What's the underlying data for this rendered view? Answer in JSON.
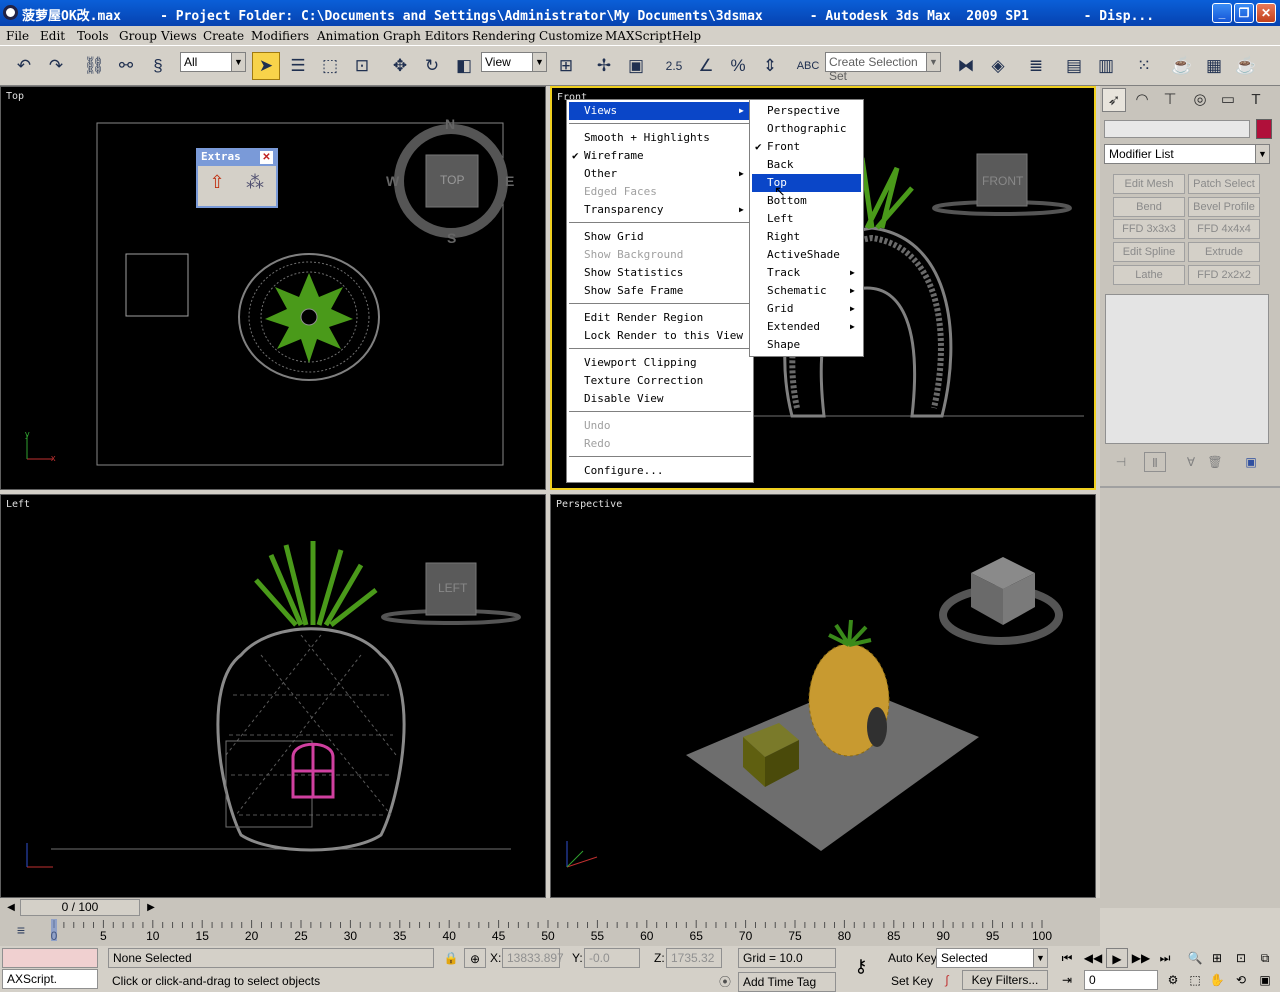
{
  "window": {
    "title": "菠萝屋OK改.max     - Project Folder: C:\\Documents and Settings\\Administrator\\My Documents\\3dsmax      - Autodesk 3ds Max  2009 SP1       - Disp..."
  },
  "menu": [
    "File",
    "Edit",
    "Tools",
    "Group",
    "Views",
    "Create",
    "Modifiers",
    "Animation",
    "Graph Editors",
    "Rendering",
    "Customize",
    "MAXScript",
    "Help"
  ],
  "toolbar": {
    "filter": "All",
    "refcoord": "View",
    "selection_set": "Create Selection Set",
    "snap_value": "2.5"
  },
  "viewports": {
    "top": "Top",
    "front": "Front",
    "left": "Left",
    "persp": "Perspective"
  },
  "viewcube": {
    "top": "TOP",
    "front": "FRONT",
    "left": "LEFT",
    "n": "N",
    "s": "S",
    "e": "E",
    "w": "W"
  },
  "extras": {
    "title": "Extras"
  },
  "context_menu": [
    {
      "label": "Views",
      "sub": true,
      "hl": true
    },
    {
      "label": "Smooth + Highlights"
    },
    {
      "label": "Wireframe",
      "check": true
    },
    {
      "label": "Other",
      "sub": true
    },
    {
      "label": "Edged Faces",
      "dis": true
    },
    {
      "label": "Transparency",
      "sub": true
    },
    {
      "label": "Show Grid"
    },
    {
      "label": "Show Background",
      "dis": true
    },
    {
      "label": "Show Statistics"
    },
    {
      "label": "Show Safe Frame"
    },
    {
      "label": "Edit Render Region"
    },
    {
      "label": "Lock Render to this View"
    },
    {
      "label": "Viewport Clipping"
    },
    {
      "label": "Texture Correction"
    },
    {
      "label": "Disable View"
    },
    {
      "label": "Undo",
      "dis": true
    },
    {
      "label": "Redo",
      "dis": true
    },
    {
      "label": "Configure..."
    }
  ],
  "views_submenu": [
    {
      "label": "Perspective"
    },
    {
      "label": "Orthographic"
    },
    {
      "label": "Front",
      "check": true
    },
    {
      "label": "Back"
    },
    {
      "label": "Top",
      "hl": true
    },
    {
      "label": "Bottom"
    },
    {
      "label": "Left"
    },
    {
      "label": "Right"
    },
    {
      "label": "ActiveShade"
    },
    {
      "label": "Track",
      "sub": true
    },
    {
      "label": "Schematic",
      "sub": true
    },
    {
      "label": "Grid",
      "sub": true
    },
    {
      "label": "Extended",
      "sub": true
    },
    {
      "label": "Shape"
    }
  ],
  "command_panel": {
    "modifier_list": "Modifier List",
    "buttons": [
      "Edit Mesh",
      "Patch Select",
      "Bend",
      "Bevel Profile",
      "FFD 3x3x3",
      "FFD 4x4x4",
      "Edit Spline",
      "Extrude",
      "Lathe",
      "FFD 2x2x2"
    ],
    "color": "#b0103a"
  },
  "timeline": {
    "frame": "0 / 100",
    "ticks": [
      "0",
      "5",
      "10",
      "15",
      "20",
      "25",
      "30",
      "35",
      "40",
      "45",
      "50",
      "55",
      "60",
      "65",
      "70",
      "75",
      "80",
      "85",
      "90",
      "95",
      "100"
    ]
  },
  "status": {
    "script": "AXScript.",
    "selection": "None Selected",
    "prompt": "Click or click-and-drag to select objects",
    "x_label": "X:",
    "x": "13833.897",
    "y_label": "Y:",
    "y": "-0.0",
    "z_label": "Z:",
    "z": "1735.32",
    "grid": "Grid = 10.0",
    "add_time_tag": "Add Time Tag",
    "auto_key": "Auto Key",
    "set_key": "Set Key",
    "selected": "Selected",
    "key_filters": "Key Filters...",
    "frame_input": "0"
  }
}
